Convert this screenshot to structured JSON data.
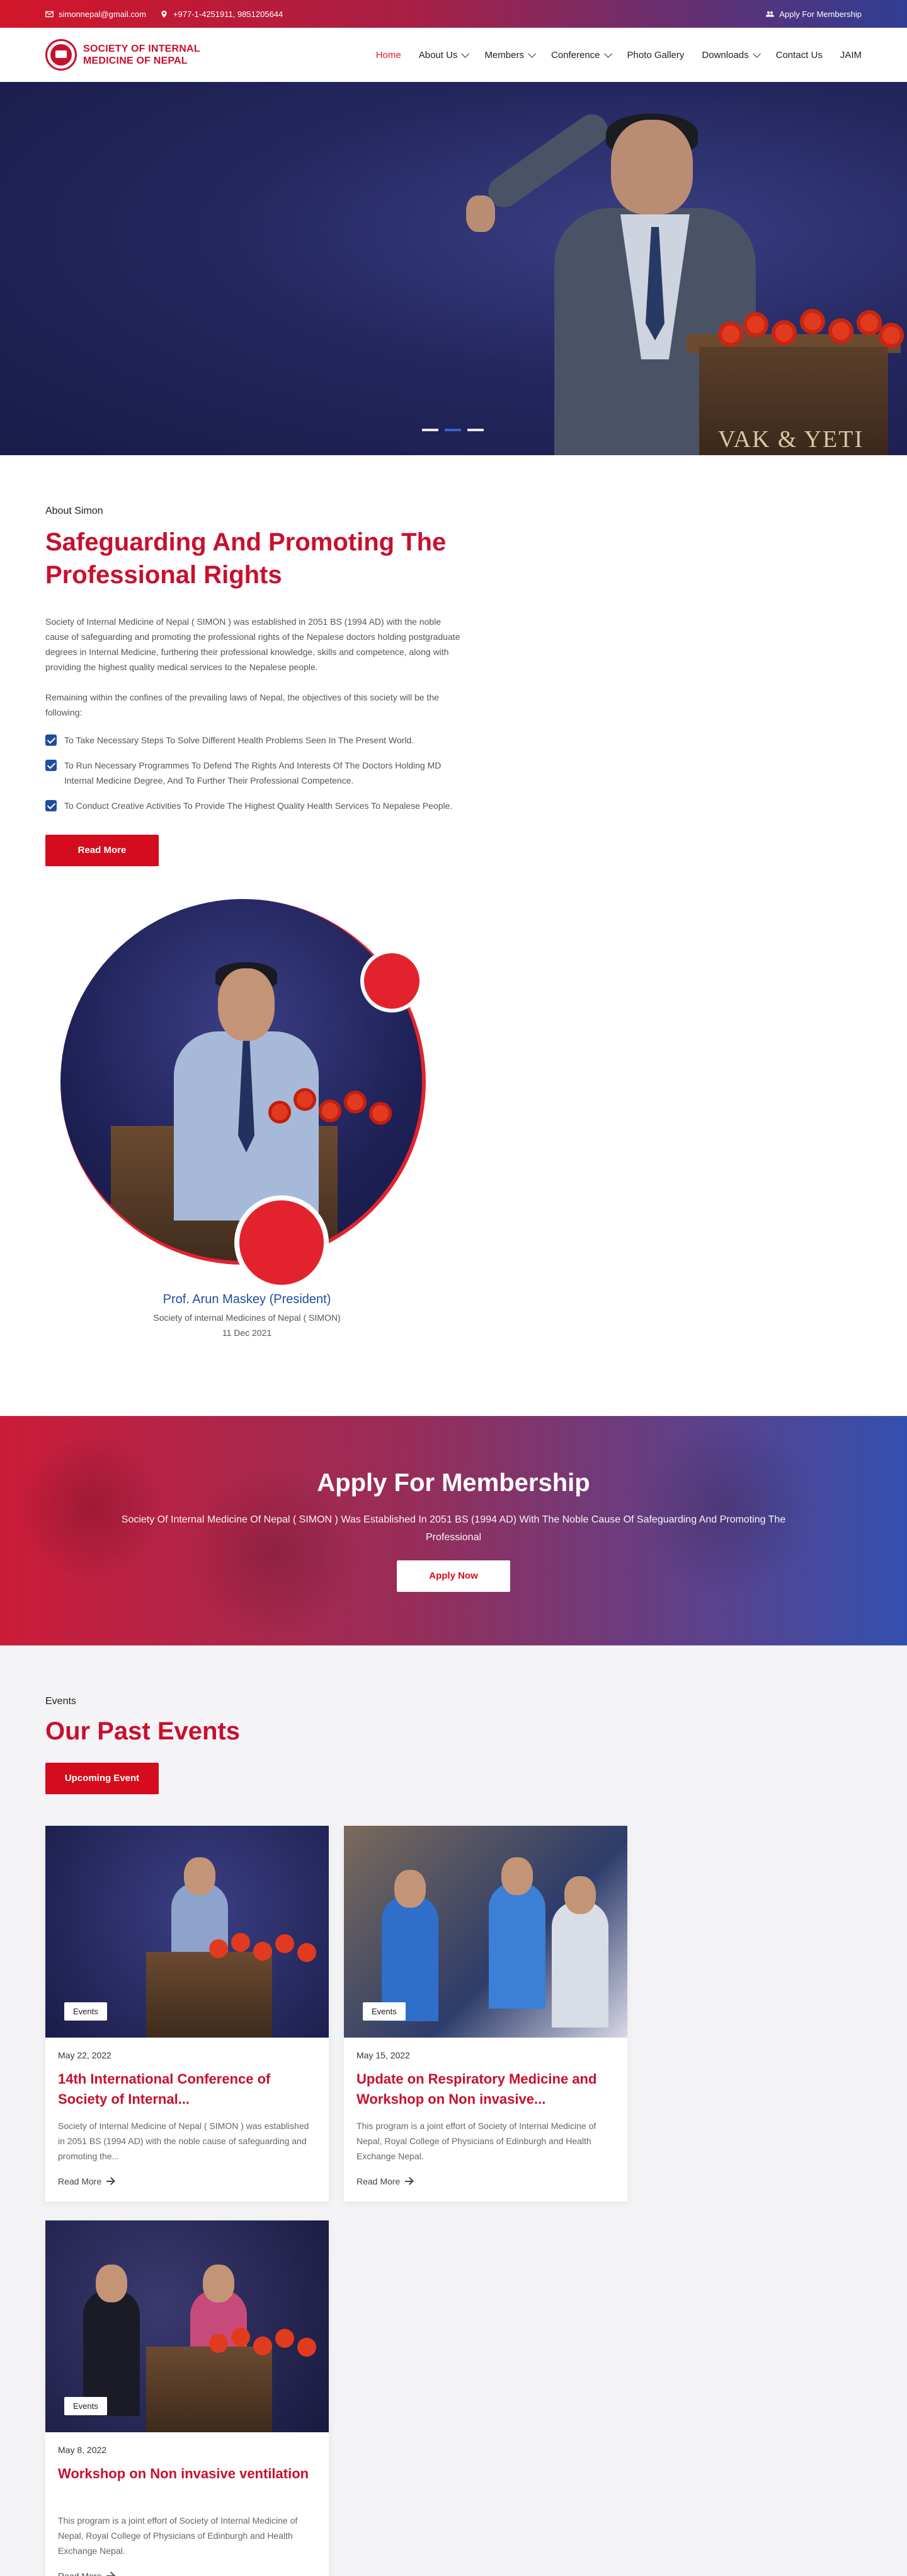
{
  "topbar": {
    "email": "simonnepal@gmail.com",
    "phone": "+977-1-4251911, 9851205644",
    "membership_link": "Apply For Membership",
    "icons": [
      "mail-icon",
      "location-pin-icon",
      "users-icon"
    ]
  },
  "header": {
    "logo_text": "SOCIETY OF INTERNAL MEDICINE OF NEPAL",
    "nav": [
      {
        "label": "Home",
        "active": true
      },
      {
        "label": "About Us",
        "dropdown": true
      },
      {
        "label": "Members",
        "dropdown": true
      },
      {
        "label": "Conference",
        "dropdown": true
      },
      {
        "label": "Photo Gallery"
      },
      {
        "label": "Downloads",
        "dropdown": true
      },
      {
        "label": "Contact Us"
      },
      {
        "label": "JAIM"
      }
    ]
  },
  "hero": {
    "podium_text": "VAK & YETI",
    "slides": 3,
    "active_slide": 2
  },
  "about": {
    "eyebrow": "About Simon",
    "title": "Safeguarding And Promoting The Professional Rights",
    "p1": "Society of Internal Medicine of Nepal ( SIMON ) was established in 2051 BS (1994 AD) with the noble cause of safeguarding and promoting the professional rights of the Nepalese doctors holding postgraduate degrees in Internal Medicine, furthering their professional knowledge, skills and competence, along with providing the highest quality medical services to the Nepalese people.",
    "p2": "Remaining within the confines of the prevailing laws of Nepal, the objectives of this society will be the following:",
    "objectives": [
      "To Take Necessary Steps To Solve Different Health Problems Seen In The Present World.",
      "To Run Necessary Programmes To Defend The Rights And Interests Of The Doctors Holding MD Internal Medicine Degree, And To Further Their Professional Competence.",
      "To Conduct Creative Activities To Provide The Highest Quality Health Services To Nepalese People."
    ],
    "read_more": "Read More"
  },
  "president": {
    "name": "Prof. Arun Maskey (President)",
    "org": "Society of internal Medicines of Nepal ( SIMON)",
    "date": "11 Dec 2021"
  },
  "membership": {
    "title": "Apply For Membership",
    "text": "Society Of Internal Medicine Of Nepal ( SIMON ) Was Established In 2051 BS (1994 AD) With The Noble Cause Of Safeguarding And Promoting The Professional",
    "button": "Apply Now"
  },
  "events": {
    "eyebrow": "Events",
    "title": "Our Past Events",
    "button": "Upcoming Event",
    "items": [
      {
        "badge": "Events",
        "date": "May 22, 2022",
        "title": "14th International Conference of Society of Internal...",
        "desc": "Society of Internal Medicine of Nepal ( SIMON ) was established in 2051 BS (1994 AD) with the noble cause of safeguarding and promoting the...",
        "more": "Read More"
      },
      {
        "badge": "Events",
        "date": "May 15, 2022",
        "title": "Update on Respiratory Medicine and Workshop on Non invasive...",
        "desc": "This program is a joint effort of Society of Internal Medicine of Nepal, Royal College of Physicians of Edinburgh and Health Exchange Nepal.",
        "more": "Read More"
      },
      {
        "badge": "Events",
        "date": "May 8, 2022",
        "title": "Workshop on Non invasive ventilation",
        "desc": "This program is a joint effort of Society of Internal Medicine of Nepal, Royal College of Physicians of Edinburgh and Health Exchange Nepal.",
        "more": "Read More"
      }
    ]
  },
  "colors": {
    "brand_red": "#c8102e",
    "button_red": "#d40c1d",
    "brand_blue": "#1f4ea0"
  }
}
